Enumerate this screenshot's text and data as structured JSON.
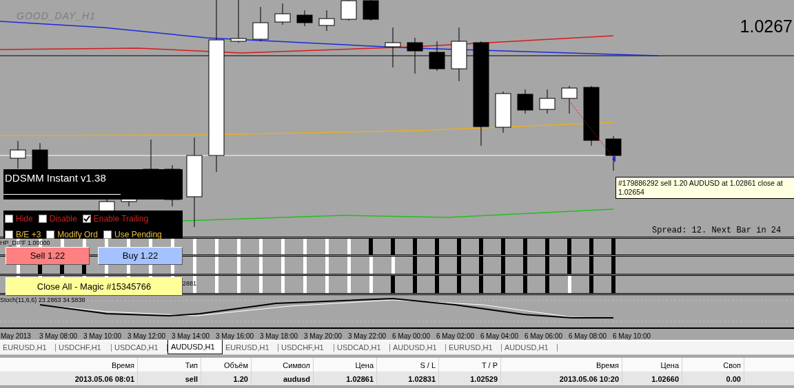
{
  "chart": {
    "title": "GOOD_DAY_H1",
    "price_label": "1.0267",
    "tooltip": "#179886292 sell 1.20 AUDUSD at 1.02861 close at 1.02654",
    "status_text": "Spread: 12. Next Bar in 24"
  },
  "panel": {
    "title": "DDSMM Instant v1.38",
    "checkbox_rows": [
      [
        {
          "label": "Hide",
          "checked": false,
          "color": "#d02020"
        },
        {
          "label": "Disable",
          "checked": false,
          "color": "#d02020"
        },
        {
          "label": "Enable Trailing",
          "checked": true,
          "color": "#d02020"
        }
      ],
      [
        {
          "label": "B/E +3",
          "checked": false,
          "color": "#e8c040"
        },
        {
          "label": "Modify Ord",
          "checked": false,
          "color": "#e8c040"
        },
        {
          "label": "Use Pending",
          "checked": false,
          "color": "#e8c040"
        }
      ]
    ],
    "buttons": [
      {
        "label": "Sell 1.22",
        "kind": "sell"
      },
      {
        "label": "Buy 1.22",
        "kind": "buy"
      },
      {
        "label": "Close All - Magic #15345766",
        "kind": "close"
      }
    ]
  },
  "signal_strips": [
    {
      "label": "HP_DIFF 1.00000",
      "bars_up": [
        true,
        true,
        true,
        true,
        true,
        true,
        true,
        true,
        true,
        true,
        true,
        true,
        true,
        true,
        true,
        true,
        false,
        false,
        false,
        false,
        false,
        false,
        false,
        false,
        false,
        false,
        false,
        false
      ]
    },
    {
      "bars_up": [
        true,
        false,
        false,
        false,
        true,
        true,
        true,
        true,
        true,
        true,
        true,
        true,
        true,
        true,
        true,
        true,
        true,
        true,
        false,
        false,
        false,
        false,
        false,
        false,
        false,
        false,
        false,
        false
      ]
    },
    {
      "value": "2881",
      "bars_up": [
        true,
        true,
        true,
        true,
        true,
        true,
        true,
        true,
        true,
        true,
        true,
        true,
        true,
        true,
        true,
        true,
        true,
        false,
        false,
        false,
        false,
        false,
        false,
        false,
        false,
        true,
        false,
        false
      ]
    }
  ],
  "oscillator": {
    "label": "Stoch(11,6,6) 23.2863 34.5838"
  },
  "time_axis": [
    "May 2013",
    "3 May 08:00",
    "3 May 10:00",
    "3 May 12:00",
    "3 May 14:00",
    "3 May 16:00",
    "3 May 18:00",
    "3 May 20:00",
    "3 May 22:00",
    "6 May 00:00",
    "6 May 02:00",
    "6 May 04:00",
    "6 May 06:00",
    "6 May 08:00",
    "6 May 10:00"
  ],
  "tabs": [
    {
      "label": "EURUSD,H1",
      "selected": false
    },
    {
      "label": "USDCHF,H1",
      "selected": false
    },
    {
      "label": "USDCAD,H1",
      "selected": false
    },
    {
      "label": "AUDUSD,H1",
      "selected": true
    },
    {
      "label": "EURUSD,H1",
      "selected": false
    },
    {
      "label": "USDCHF,H1",
      "selected": false
    },
    {
      "label": "USDCAD,H1",
      "selected": false
    },
    {
      "label": "AUDUSD,H1",
      "selected": false
    },
    {
      "label": "EURUSD,H1",
      "selected": false
    },
    {
      "label": "AUDUSD,H1",
      "selected": false
    }
  ],
  "table": {
    "columns": [
      "Время",
      "Тип",
      "Объём",
      "Символ",
      "Цена",
      "S / L",
      "T / P",
      "Время",
      "Цена",
      "Своп"
    ],
    "rows": [
      [
        "2013.05.06 08:01",
        "sell",
        "1.20",
        "audusd",
        "1.02861",
        "1.02831",
        "1.02529",
        "2013.05.06 10:20",
        "1.02660",
        "0.00"
      ]
    ]
  }
}
